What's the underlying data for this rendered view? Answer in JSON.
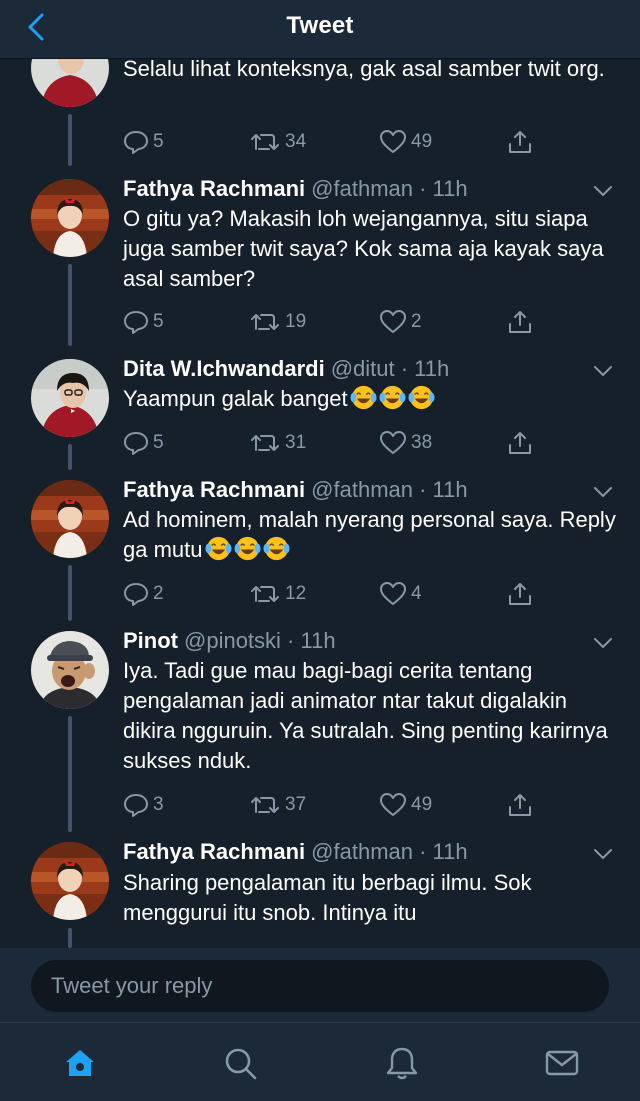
{
  "header": {
    "title": "Tweet",
    "back_icon": "chevron-left-icon"
  },
  "tweets": [
    {
      "name": "",
      "handle": "",
      "time": "",
      "text": "Selalu lihat konteksnya, gak asal samber twit org.",
      "emojis": 0,
      "counts": {
        "replies": "5",
        "retweets": "34",
        "likes": "49"
      }
    },
    {
      "name": "Fathya Rachmani",
      "handle": "@fathman · 11h",
      "text": "O gitu ya? Makasih loh wejangannya, situ siapa juga samber twit saya? Kok sama aja kayak saya asal samber?",
      "emojis": 0,
      "counts": {
        "replies": "5",
        "retweets": "19",
        "likes": "2"
      }
    },
    {
      "name": "Dita W.Ichwandardi",
      "handle": "@ditut · 11h",
      "text": "Yaampun galak banget",
      "emojis": 3,
      "counts": {
        "replies": "5",
        "retweets": "31",
        "likes": "38"
      }
    },
    {
      "name": "Fathya Rachmani",
      "handle": "@fathman · 11h",
      "text": "Ad hominem, malah nyerang personal saya. Reply ga mutu",
      "emojis": 3,
      "counts": {
        "replies": "2",
        "retweets": "12",
        "likes": "4"
      }
    },
    {
      "name": "Pinot",
      "handle": "@pinotski · 11h",
      "text": "Iya. Tadi gue mau bagi-bagi cerita tentang pengalaman jadi animator ntar takut digalakin dikira ngguruin. Ya sutralah. Sing penting karirnya sukses nduk.",
      "emojis": 0,
      "counts": {
        "replies": "3",
        "retweets": "37",
        "likes": "49"
      }
    },
    {
      "name": "Fathya Rachmani",
      "handle": "@fathman · 11h",
      "text": "Sharing pengalaman itu berbagi ilmu. Sok menggurui itu snob. Intinya itu",
      "emojis": 0,
      "counts": {
        "replies": "",
        "retweets": "",
        "likes": ""
      }
    }
  ],
  "reply": {
    "placeholder": "Tweet your reply"
  },
  "tabbar": {
    "items": [
      "home-icon",
      "search-icon",
      "notifications-icon",
      "messages-icon"
    ]
  },
  "colors": {
    "background": "#15202b",
    "bar": "#1c2938",
    "accent": "#1da1f2",
    "muted": "#8899a6"
  }
}
